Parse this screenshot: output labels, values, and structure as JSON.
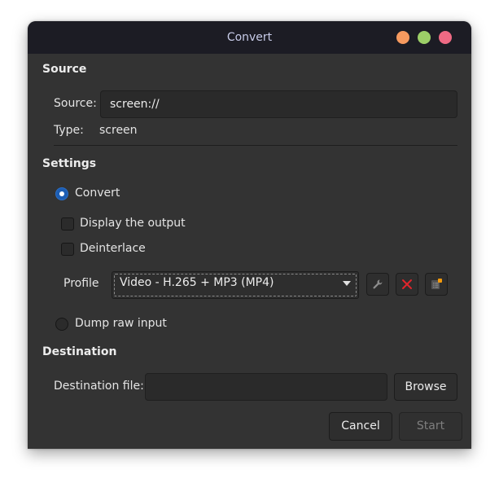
{
  "window": {
    "title": "Convert",
    "controls": {
      "minimize_color": "#f79a5f",
      "maximize_color": "#9ccf67",
      "close_color": "#ef6a84"
    }
  },
  "source": {
    "section_title": "Source",
    "source_label": "Source:",
    "source_value": "screen://",
    "type_label": "Type:",
    "type_value": "screen"
  },
  "settings": {
    "section_title": "Settings",
    "convert_label": "Convert",
    "convert_selected": true,
    "display_output_label": "Display the output",
    "display_output_checked": false,
    "deinterlace_label": "Deinterlace",
    "deinterlace_checked": false,
    "profile_label": "Profile",
    "profile_value": "Video - H.265 + MP3 (MP4)",
    "profile_tools": [
      {
        "name": "edit-profile",
        "icon": "wrench-icon"
      },
      {
        "name": "delete-profile",
        "icon": "delete-x-icon"
      },
      {
        "name": "new-profile",
        "icon": "new-profile-icon"
      }
    ],
    "dump_raw_label": "Dump raw input",
    "dump_raw_selected": false
  },
  "destination": {
    "section_title": "Destination",
    "file_label": "Destination file:",
    "file_value": "",
    "browse_label": "Browse"
  },
  "footer": {
    "cancel_label": "Cancel",
    "start_label": "Start",
    "start_enabled": false
  },
  "colors": {
    "accent": "#1c5db3",
    "delete_red": "#e0252b",
    "badge_orange": "#f59a0b"
  }
}
